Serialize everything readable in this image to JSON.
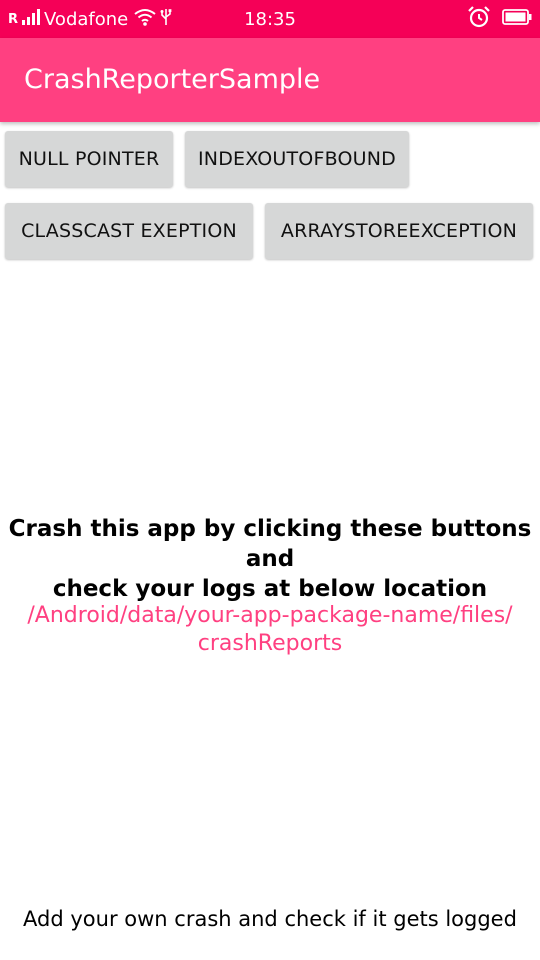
{
  "status_bar": {
    "carrier": "Vodafone",
    "roaming_indicator": "R",
    "time": "18:35",
    "icons": [
      "signal-icon",
      "wifi-icon",
      "usb-icon",
      "alarm-icon",
      "battery-icon"
    ]
  },
  "app_bar": {
    "title": "CrashReporterSample"
  },
  "buttons": {
    "null_pointer": "NULL POINTER",
    "index_out_of_bound": "INDEXOUTOFBOUND",
    "class_cast": "CLASSCAST EXEPTION",
    "array_store": "ARRAYSTOREEXCEPTION"
  },
  "main": {
    "instruction_line1": "Crash this app by clicking these buttons and",
    "instruction_line2": "check your logs at below location",
    "path_line1": "/Android/data/your-app-package-name/files/",
    "path_line2": "crashReports"
  },
  "footer": {
    "text": "Add your own crash and check if it gets logged"
  },
  "colors": {
    "status_bar": "#f50057",
    "app_bar": "#ff4081",
    "button": "#d6d7d7",
    "path_text": "#ff4081"
  }
}
